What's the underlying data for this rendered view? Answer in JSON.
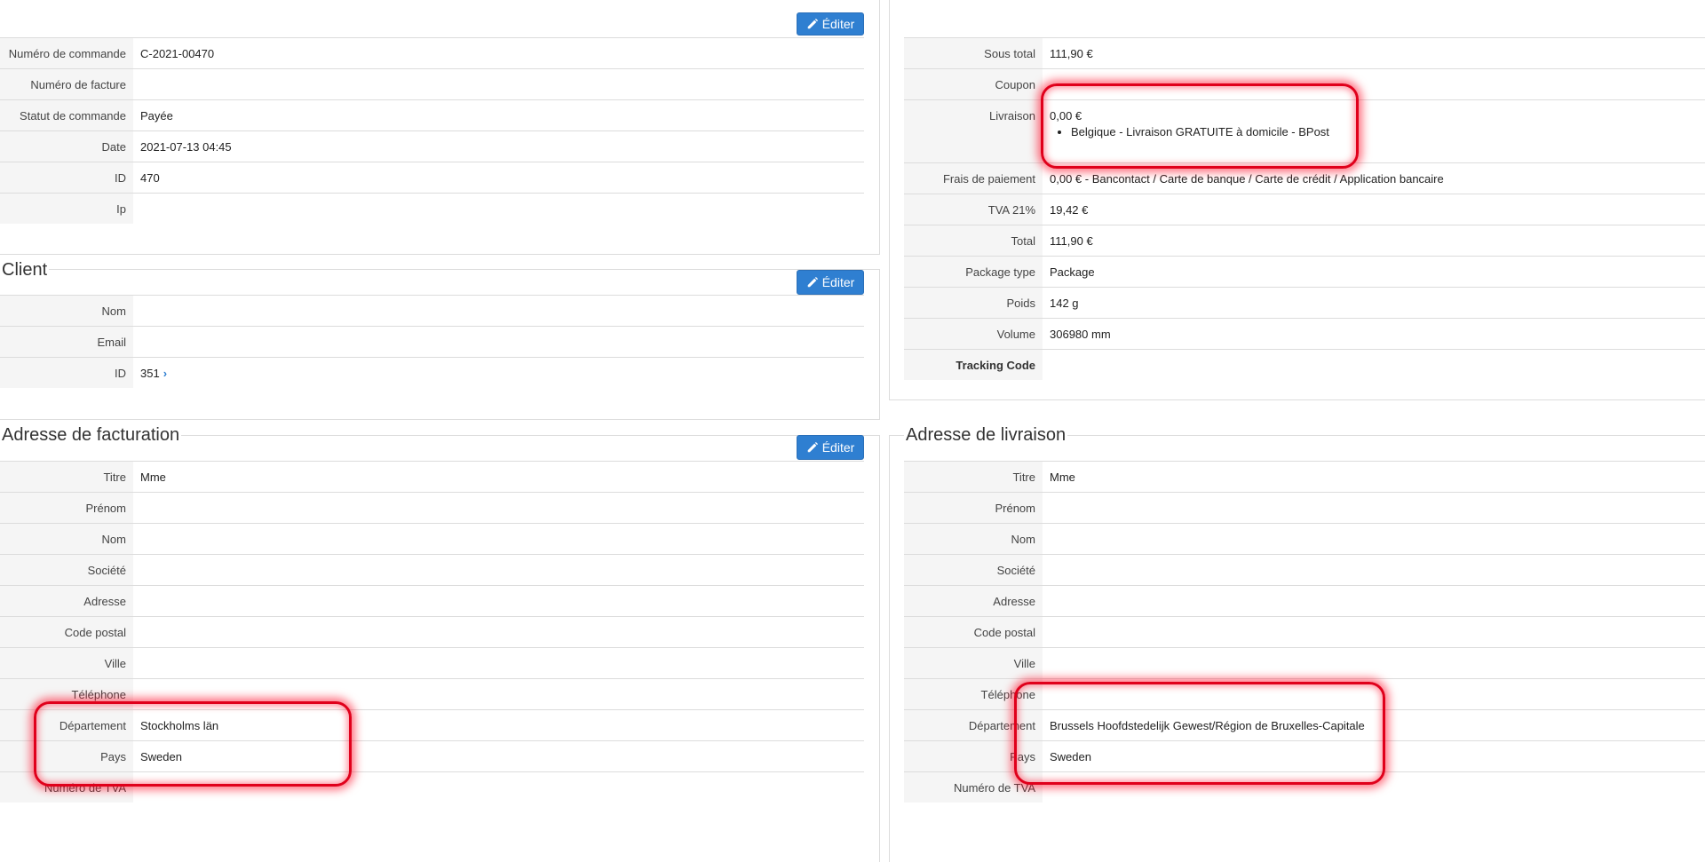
{
  "buttons": {
    "edit_label": "Éditer"
  },
  "order": {
    "rows": [
      {
        "label": "Numéro de commande",
        "value": "C-2021-00470"
      },
      {
        "label": "Numéro de facture",
        "value": ""
      },
      {
        "label": "Statut de commande",
        "value": "Payée"
      },
      {
        "label": "Date",
        "value": "2021-07-13 04:45"
      },
      {
        "label": "ID",
        "value": "470"
      },
      {
        "label": "Ip",
        "value": ""
      }
    ]
  },
  "client": {
    "title": "Client",
    "rows": [
      {
        "label": "Nom",
        "value": ""
      },
      {
        "label": "Email",
        "value": ""
      },
      {
        "label": "ID",
        "value": "351"
      }
    ]
  },
  "totals": {
    "rows": [
      {
        "label": "Sous total",
        "value": "111,90 €"
      },
      {
        "label": "Coupon",
        "value": ""
      },
      {
        "label": "Livraison",
        "value": "0,00 €",
        "detail": "Belgique - Livraison GRATUITE à domicile - BPost"
      },
      {
        "label": "Frais de paiement",
        "value": "0,00 € - Bancontact / Carte de banque / Carte de crédit / Application bancaire"
      },
      {
        "label": "TVA 21%",
        "value": "19,42 €"
      },
      {
        "label": "Total",
        "value": "111,90 €"
      },
      {
        "label": "Package type",
        "value": "Package"
      },
      {
        "label": "Poids",
        "value": "142 g"
      },
      {
        "label": "Volume",
        "value": "306980 mm"
      },
      {
        "label": "Tracking Code",
        "value": ""
      }
    ]
  },
  "billing": {
    "title": "Adresse de facturation",
    "rows": [
      {
        "label": "Titre",
        "value": "Mme"
      },
      {
        "label": "Prénom",
        "value": ""
      },
      {
        "label": "Nom",
        "value": ""
      },
      {
        "label": "Société",
        "value": ""
      },
      {
        "label": "Adresse",
        "value": ""
      },
      {
        "label": "Code postal",
        "value": ""
      },
      {
        "label": "Ville",
        "value": ""
      },
      {
        "label": "Téléphone",
        "value": ""
      },
      {
        "label": "Département",
        "value": "Stockholms län"
      },
      {
        "label": "Pays",
        "value": "Sweden"
      },
      {
        "label": "Numéro de TVA",
        "value": ""
      }
    ]
  },
  "shipping": {
    "title": "Adresse de livraison",
    "rows": [
      {
        "label": "Titre",
        "value": "Mme"
      },
      {
        "label": "Prénom",
        "value": ""
      },
      {
        "label": "Nom",
        "value": ""
      },
      {
        "label": "Société",
        "value": ""
      },
      {
        "label": "Adresse",
        "value": ""
      },
      {
        "label": "Code postal",
        "value": ""
      },
      {
        "label": "Ville",
        "value": ""
      },
      {
        "label": "Téléphone",
        "value": ""
      },
      {
        "label": "Département",
        "value": "Brussels Hoofdstedelijk Gewest/Région de Bruxelles-Capitale"
      },
      {
        "label": "Pays",
        "value": "Sweden"
      },
      {
        "label": "Numéro de TVA",
        "value": ""
      }
    ]
  },
  "icons": {
    "edit": "pencil-icon",
    "link": "chevron-right-icon"
  },
  "colors": {
    "button": "#2f7fd1",
    "highlight": "#e0001b"
  }
}
